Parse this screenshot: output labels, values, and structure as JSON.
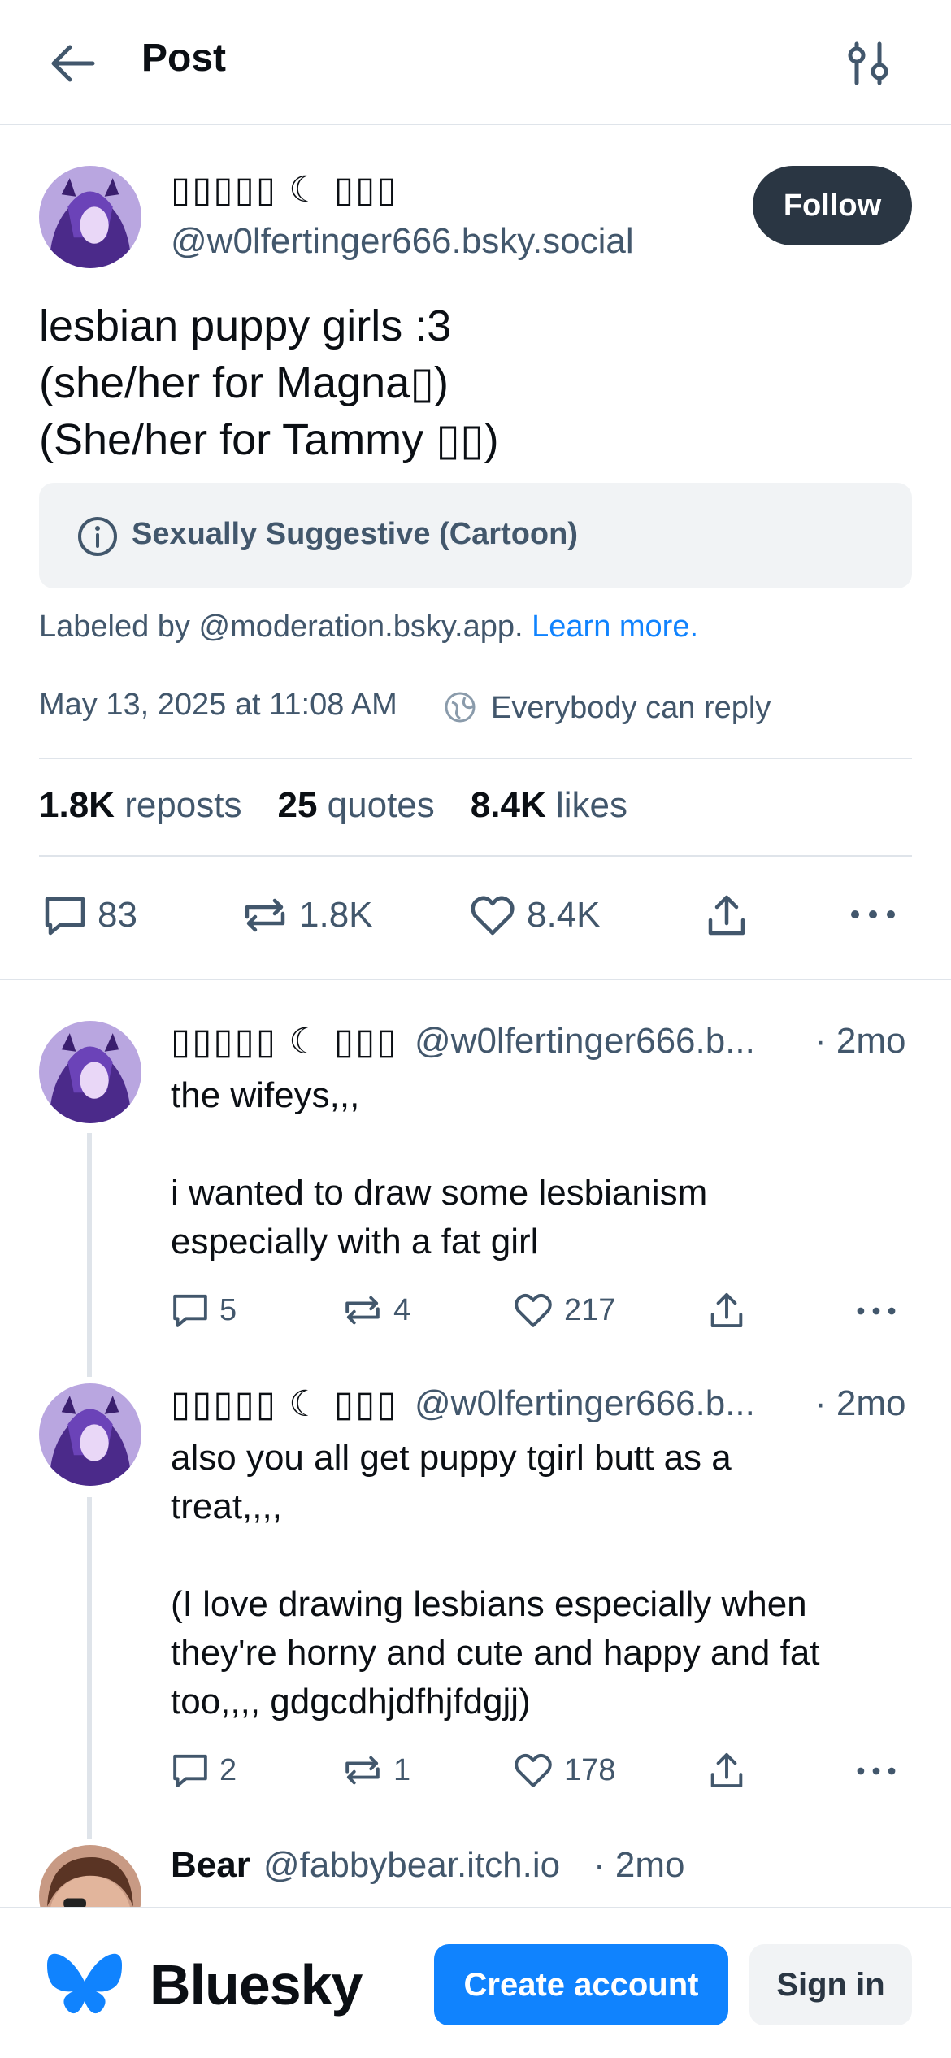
{
  "header": {
    "title": "Post",
    "back_icon": "arrow-left-icon",
    "settings_icon": "sliders-icon"
  },
  "main_post": {
    "author_name": "▯▯▯▯▯ ☾ ▯▯▯",
    "handle": "@w0lfertinger666.bsky.social",
    "follow_label": "Follow",
    "text_lines": [
      "lesbian puppy girls :3",
      "(she/her for Magna▯)",
      "(She/her for Tammy ▯▯)"
    ],
    "label": "Sexually Suggestive (Cartoon)",
    "labeled_by": "Labeled by @moderation.bsky.app.",
    "learn_more": "Learn more.",
    "timestamp": "May 13, 2025 at 11:08 AM",
    "reply_setting": "Everybody can reply",
    "stats": {
      "reposts_count": "1.8K",
      "reposts_label": "reposts",
      "quotes_count": "25",
      "quotes_label": "quotes",
      "likes_count": "8.4K",
      "likes_label": "likes"
    },
    "actions": {
      "replies": "83",
      "reposts": "1.8K",
      "likes": "8.4K"
    }
  },
  "replies": [
    {
      "author_name": "▯▯▯▯▯ ☾ ▯▯▯",
      "handle": "@w0lfertinger666.b...",
      "time": "· 2mo",
      "text_lines": [
        "the wifeys,,,",
        "",
        "i wanted to draw some lesbianism",
        "especially with a fat girl"
      ],
      "replies": "5",
      "reposts": "4",
      "likes": "217"
    },
    {
      "author_name": "▯▯▯▯▯ ☾ ▯▯▯",
      "handle": "@w0lfertinger666.b...",
      "time": "· 2mo",
      "text_lines": [
        "also you all get puppy tgirl butt as a",
        "treat,,,,",
        "",
        "(I love drawing lesbians especially when",
        "they're horny and cute and happy and fat",
        "too,,,, gdgcdhjdfhjfdgjj)"
      ],
      "replies": "2",
      "reposts": "1",
      "likes": "178"
    },
    {
      "author_name": "Bear",
      "handle": "@fabbybear.itch.io",
      "time": "· 2mo"
    }
  ],
  "footer": {
    "brand": "Bluesky",
    "create_account": "Create account",
    "sign_in": "Sign in"
  },
  "colors": {
    "accent": "#1083fe",
    "text": "#0b0f14",
    "muted": "#42576c",
    "divider": "#dfe4ea",
    "follow_bg": "#2a3643"
  }
}
